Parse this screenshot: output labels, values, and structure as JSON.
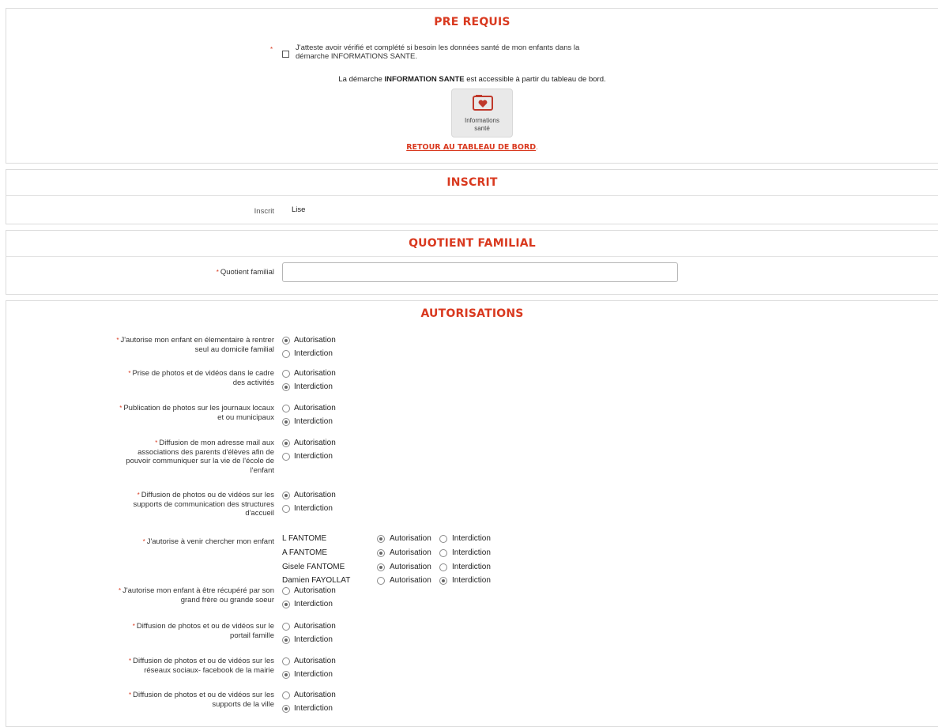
{
  "prerequis": {
    "title": "PRE REQUIS",
    "attest_text": "J'atteste avoir vérifié et complété si besoin les données santé de mon enfants dans la démarche INFORMATIONS SANTE.",
    "attest_line1": "J'atteste avoir vérifié et complété si besoin les données santé de mon enfants dans la",
    "attest_line2": "démarche INFORMATIONS SANTE.",
    "info_prefix": "La démarche ",
    "info_bold": "INFORMATION SANTE",
    "info_suffix": " est accessible à partir du tableau de bord.",
    "tile_label_1": "Informations",
    "tile_label_2": "santé",
    "tile_icon": "health-folder-icon",
    "back_link": "RETOUR AU TABLEAU DE BORD",
    "back_link_suffix": "."
  },
  "inscrit": {
    "title": "INSCRIT",
    "label": "Inscrit",
    "value": "Lise"
  },
  "quotient": {
    "title": "QUOTIENT FAMILIAL",
    "label": "Quotient familial",
    "value": ""
  },
  "autorisations": {
    "title": "AUTORISATIONS",
    "opt_yes": "Autorisation",
    "opt_no": "Interdiction",
    "questions": [
      {
        "label_lines": [
          "J'autorise mon enfant en élementaire à rentrer",
          "seul au domicile familial"
        ],
        "selected": "Autorisation"
      },
      {
        "label_lines": [
          "Prise de photos et de vidéos dans le cadre",
          "des activités"
        ],
        "selected": "Interdiction"
      },
      {
        "label_lines": [
          "Publication de photos sur les journaux locaux",
          "et ou municipaux"
        ],
        "selected": "Interdiction"
      },
      {
        "label_lines": [
          "Diffusion de mon adresse mail aux",
          "associations des parents d'élèves afin de",
          "pouvoir communiquer sur la vie de l'école de",
          "l'enfant"
        ],
        "selected": "Autorisation"
      },
      {
        "label_lines": [
          "Diffusion de photos ou de vidéos sur les",
          "supports de communication des structures",
          "d'accueil"
        ],
        "selected": "Autorisation"
      },
      {
        "label_lines": [
          "J'autorise mon enfant à être récupéré par son",
          "grand frère ou grande soeur"
        ],
        "selected": "Interdiction"
      },
      {
        "label_lines": [
          "Diffusion de photos et ou de vidéos sur le",
          "portail famille"
        ],
        "selected": "Interdiction"
      },
      {
        "label_lines": [
          "Diffusion de photos et ou de vidéos sur les",
          "réseaux sociaux- facebook de la mairie"
        ],
        "selected": "Interdiction"
      },
      {
        "label_lines": [
          "Diffusion de photos et ou de vidéos sur les",
          "supports de la ville"
        ],
        "selected": "Interdiction"
      }
    ],
    "pickup": {
      "label": "J'autorise à venir chercher mon enfant",
      "persons": [
        {
          "name": "L FANTOME",
          "selected": "Autorisation"
        },
        {
          "name": "A FANTOME",
          "selected": "Autorisation"
        },
        {
          "name": "Gisele FANTOME",
          "selected": "Autorisation"
        },
        {
          "name": "Damien FAYOLLAT",
          "selected": "Interdiction"
        }
      ]
    }
  },
  "colors": {
    "accent": "#d9391f",
    "border": "#dcdcdc"
  }
}
